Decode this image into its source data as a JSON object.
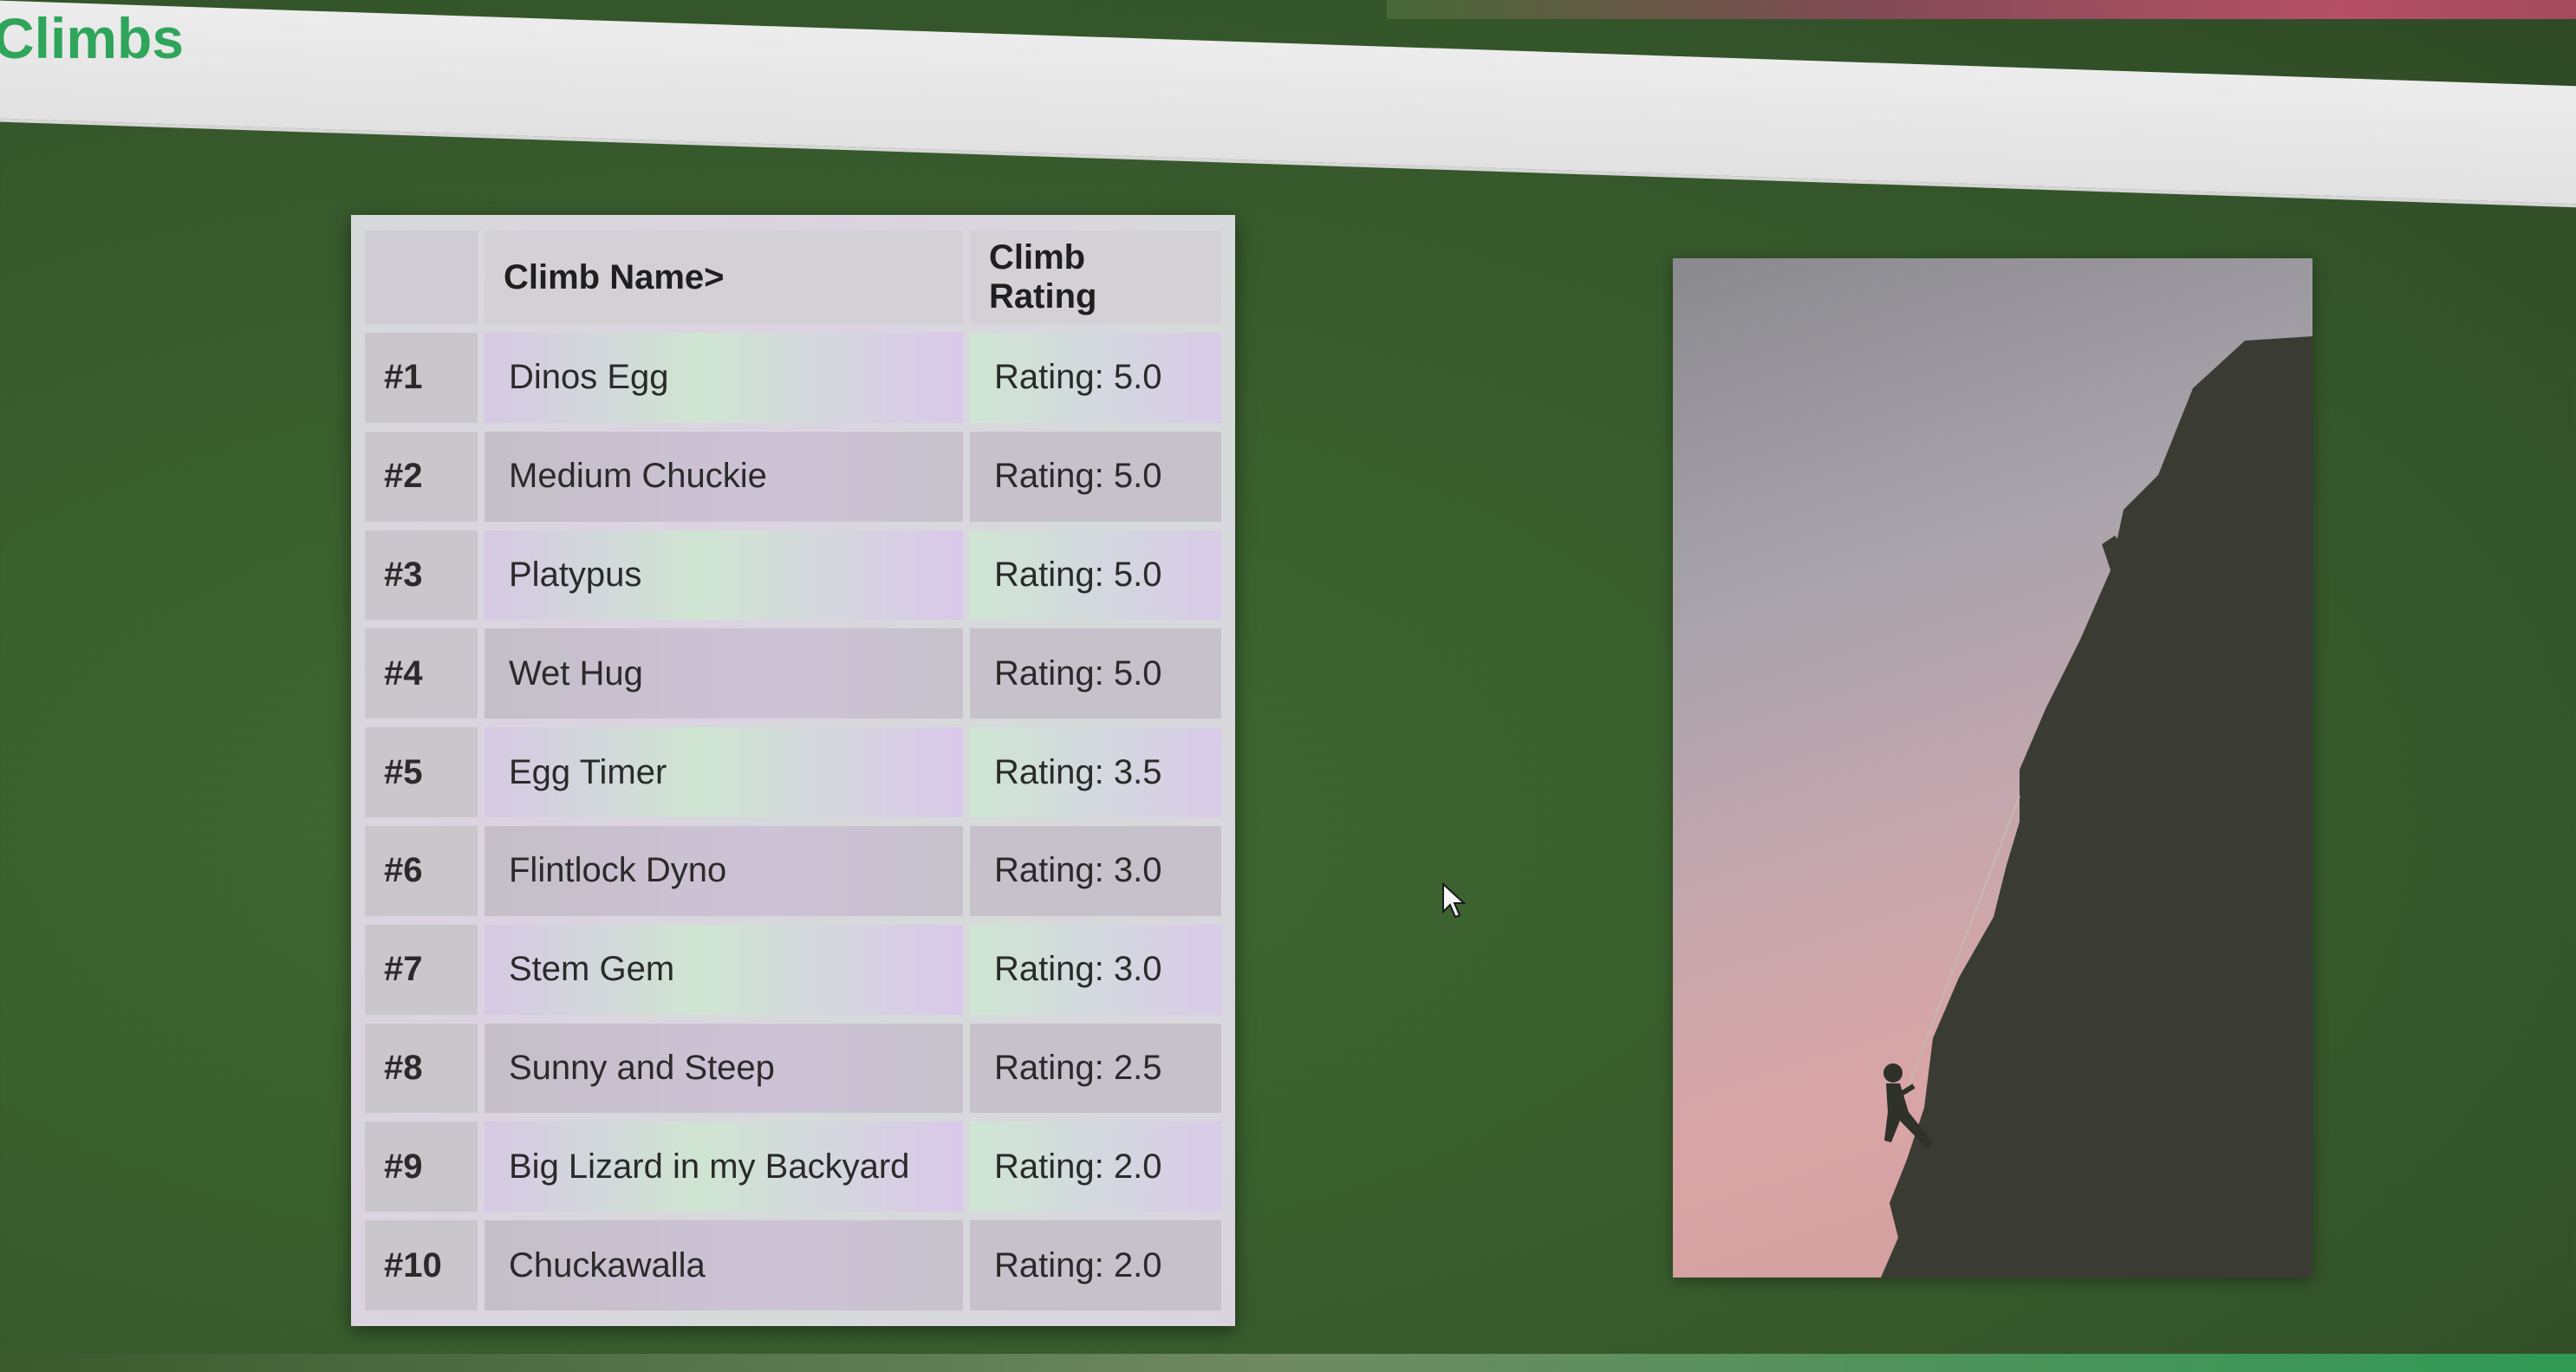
{
  "page": {
    "title": "Climbs",
    "accent_color": "#2fa55b",
    "background_color": "#3a5f2d"
  },
  "table": {
    "headers": {
      "rank": "",
      "name": "Climb Name>",
      "rating": "Climb Rating"
    },
    "rows": [
      {
        "rank": "#1",
        "name": "Dinos Egg",
        "rating": "Rating: 5.0"
      },
      {
        "rank": "#2",
        "name": "Medium Chuckie",
        "rating": "Rating: 5.0"
      },
      {
        "rank": "#3",
        "name": "Platypus",
        "rating": "Rating: 5.0"
      },
      {
        "rank": "#4",
        "name": "Wet Hug",
        "rating": "Rating: 5.0"
      },
      {
        "rank": "#5",
        "name": "Egg Timer",
        "rating": "Rating: 3.5"
      },
      {
        "rank": "#6",
        "name": "Flintlock Dyno",
        "rating": "Rating: 3.0"
      },
      {
        "rank": "#7",
        "name": "Stem Gem",
        "rating": "Rating: 3.0"
      },
      {
        "rank": "#8",
        "name": "Sunny and Steep",
        "rating": "Rating: 2.5"
      },
      {
        "rank": "#9",
        "name": "Big Lizard in my Backyard",
        "rating": "Rating: 2.0"
      },
      {
        "rank": "#10",
        "name": "Chuckawalla",
        "rating": "Rating: 2.0"
      }
    ]
  },
  "icons": {
    "cursor": "mouse-pointer-icon"
  }
}
